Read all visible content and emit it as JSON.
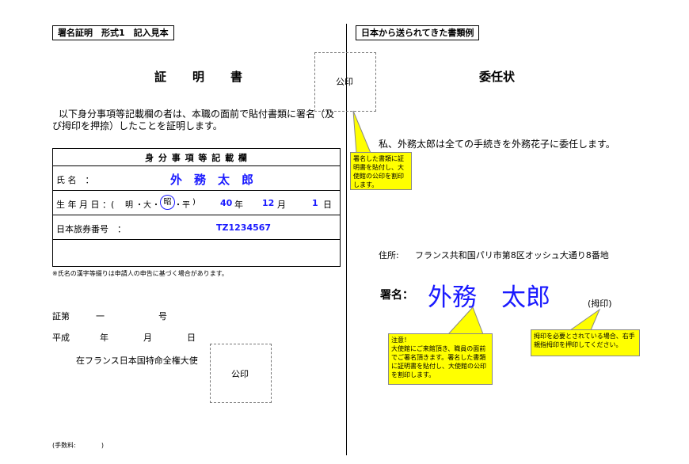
{
  "left": {
    "header": "署名証明　形式1　記入見本",
    "title": "証　　明　　書",
    "seal_label": "公印",
    "statement": "以下身分事項等記載欄の者は、本職の面前で貼付書類に署名（及び拇印を押捺）したことを証明します。",
    "table": {
      "heading": "身 分 事 項 等 記 載 欄",
      "name_label": "氏 名　：",
      "name_value": "外　務　太　郎",
      "dob_label": "生 年 月 日 ：(",
      "era_meiji": "明",
      "era_taisho": "大",
      "era_showa": "昭",
      "era_heisei": "平",
      "dob_close": ")",
      "dob_year": "40",
      "dob_year_unit": "年",
      "dob_month": "12",
      "dob_month_unit": "月",
      "dob_day": "1",
      "dob_day_unit": "日",
      "passport_label": "日本旅券番号　：",
      "passport_value": "TZ1234567"
    },
    "note": "※氏名の漢字等綴りは申請人の申告に基づく場合があります。",
    "cert_no_label": "証第",
    "cert_no_dash": "一",
    "cert_no_unit": "号",
    "date_era": "平成",
    "date_year": "年",
    "date_month": "月",
    "date_day": "日",
    "issuer": "在フランス日本国特命全権大使",
    "seal_label_bottom": "公印",
    "fee": "(手数料:　　　　)"
  },
  "right": {
    "header": "日本から送られてきた書類例",
    "title": "委任状",
    "delegation": "私、外務太郎は全ての手続きを外務花子に委任します。",
    "address_label": "住所:",
    "address_value": "フランス共和国パリ市第8区オッシュ大通り8番地",
    "signature_label": "署名：",
    "signature_value": "外務　太郎",
    "thumbprint_label": "(拇印)"
  },
  "callouts": {
    "seal_note": "署名した書類に証明書を貼付し、大使館の公印を割印します。",
    "caution": "注意！\n大使館にご来館頂き、職員の面前でご署名頂きます。署名した書類に証明書を貼付し、大使館の公印を割印します。",
    "thumbprint_note": "拇印を必要とされている場合、右手親指拇印を押印してください。"
  },
  "colors": {
    "callout": "#ffff00",
    "name_blue": "#1a1aff"
  }
}
